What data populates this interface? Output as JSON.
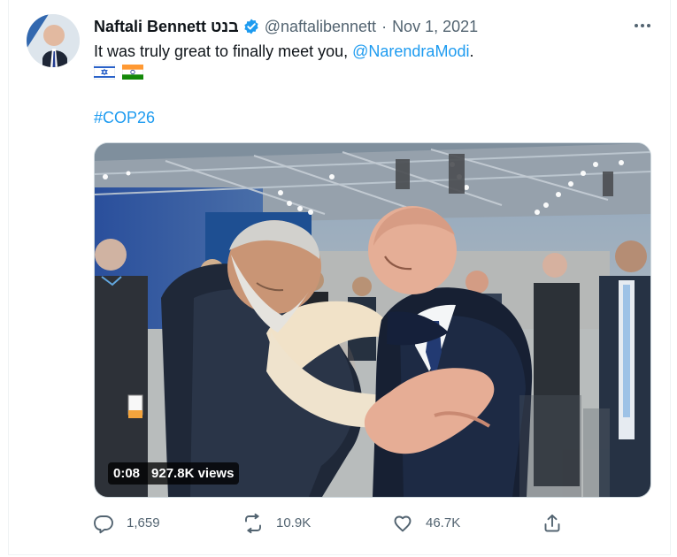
{
  "author": {
    "display_name": "Naftali Bennett בנט",
    "handle": "@naftalibennett",
    "separator": "·",
    "date": "Nov 1, 2021"
  },
  "tweet": {
    "text_prefix": "It was truly great to finally meet you, ",
    "mention": "@NarendraModi",
    "text_suffix": ".",
    "flags": [
      "israel-flag",
      "india-flag"
    ],
    "hashtag": "#COP26"
  },
  "media": {
    "duration": "0:08",
    "views": "927.8K views"
  },
  "actions": {
    "reply": "1,659",
    "retweet": "10.9K",
    "like": "46.7K"
  },
  "colors": {
    "link": "#1d9bf0",
    "secondary_text": "#536471",
    "verified": "#1d9bf0"
  }
}
